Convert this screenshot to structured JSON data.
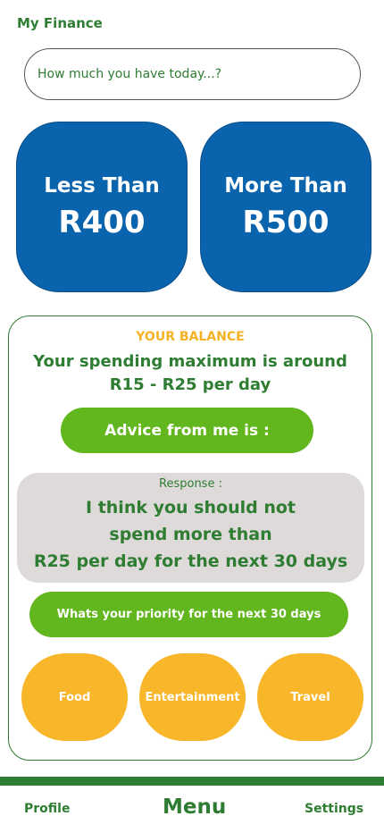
{
  "app": {
    "title": "My Finance"
  },
  "amount_input": {
    "placeholder": "How much you have today...?"
  },
  "amount_options": [
    {
      "line1": "Less Than",
      "line2": "R400"
    },
    {
      "line1": "More Than",
      "line2": "R500"
    }
  ],
  "balance": {
    "label": "YOUR BALANCE",
    "spending_line1": "Your spending maximum is around",
    "spending_line2": "R15 - R25 per day"
  },
  "advice": {
    "button_label": "Advice from me is :"
  },
  "response": {
    "label": "Response :",
    "line1": "I think you should not",
    "line2": "spend more than",
    "line3": "R25 per day for the next 30 days"
  },
  "priority": {
    "button_label": "Whats your priority for the next 30 days",
    "categories": [
      "Food",
      "Entertainment",
      "Travel"
    ]
  },
  "nav": {
    "profile": "Profile",
    "menu": "Menu",
    "settings": "Settings"
  },
  "colors": {
    "primary_green": "#2e7d32",
    "light_green": "#62b61e",
    "blue": "#0a63ad",
    "orange": "#f8b62b",
    "balance_label": "#f5b324",
    "response_bg": "#dedad9"
  }
}
